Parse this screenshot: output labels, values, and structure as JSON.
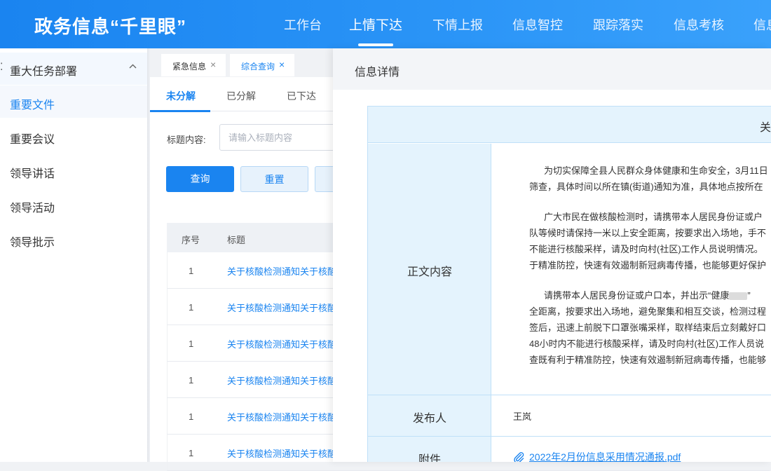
{
  "app": {
    "brand": "政务信息“千里眼”",
    "nav": [
      "工作台",
      "上情下达",
      "下情上报",
      "信息智控",
      "跟踪落实",
      "信息考核",
      "信息"
    ],
    "nav_active": "上情下达"
  },
  "sidebar": {
    "group_label": "重大任务部署",
    "items": [
      "重要文件",
      "重要会议",
      "领导讲话",
      "领导活动",
      "领导批示"
    ],
    "active": "重要文件"
  },
  "tabs": [
    {
      "label": "紧急信息",
      "active": false
    },
    {
      "label": "综合查询",
      "active": true
    }
  ],
  "subtabs": [
    "未分解",
    "已分解",
    "已下达"
  ],
  "filter": {
    "label": "标题内容:",
    "placeholder": "请输入标题内容",
    "query_label": "查询",
    "reset_label": "重置"
  },
  "table": {
    "columns": [
      "序号",
      "标题"
    ],
    "rows": [
      {
        "idx": "1",
        "title": "关于核酸检测通知关于核酸"
      },
      {
        "idx": "1",
        "title": "关于核酸检测通知关于核酸"
      },
      {
        "idx": "1",
        "title": "关于核酸检测通知关于核酸"
      },
      {
        "idx": "1",
        "title": "关于核酸检测通知关于核酸"
      },
      {
        "idx": "1",
        "title": "关于核酸检测通知关于核酸"
      },
      {
        "idx": "1",
        "title": "关于核酸检测通知关于核酸"
      }
    ]
  },
  "drawer": {
    "title": "信息详情",
    "header_text": "关",
    "content_label": "正文内容",
    "paragraphs": [
      [
        "为切实保障全县人民群众身体健康和生命安全，3月11日",
        "筛查，具体时间以所在镇(街道)通知为准，具体地点按所在"
      ],
      [
        "广大市民在做核酸检测时，请携带本人居民身份证或户",
        "队等候时请保持一米以上安全距离，按要求出入场地，手不",
        "不能进行核酸采样，请及时向村(社区)工作人员说明情况。",
        "于精准防控，快速有效遏制新冠病毒传播，也能够更好保护"
      ],
      [
        "请携带本人居民身份证或户口本，并出示“健康",
        "全距离，按要求出入场地，避免聚集和相互交谈，检测过程",
        "签后，迅速上前脱下口罩张嘴采样，取样结束后立刻戴好口",
        "48小时内不能进行核酸采样，请及时向村(社区)工作人员说",
        "查既有利于精准防控，快速有效遏制新冠病毒传播，也能够"
      ]
    ],
    "quote_close": "”",
    "publisher_label": "发布人",
    "publisher": "王岚",
    "attachment_label": "附件",
    "attachment": "2022年2月份信息采用情况通报.pdf"
  }
}
